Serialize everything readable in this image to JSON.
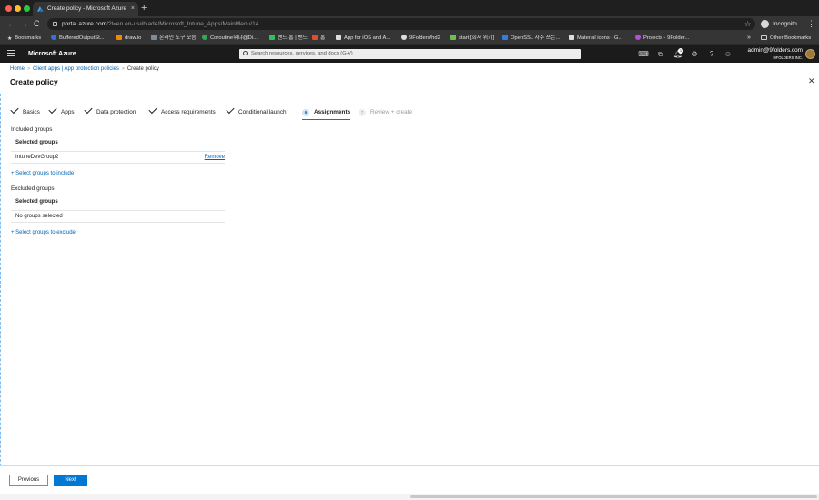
{
  "browser": {
    "tab_title": "Create policy - Microsoft Azure",
    "tab_close": "×",
    "new_tab": "+",
    "url_host": "portal.azure.com",
    "url_path": "/?l=en.en-us#blade/Microsoft_Intune_Apps/MainMenu/14",
    "profile_label": "Incognito",
    "nav_back": "←",
    "nav_forward": "→",
    "nav_reload": "C",
    "bookmark_star": "☆",
    "menu": "⋮",
    "bookmarks": [
      {
        "label": "Bookmarks",
        "color": "#e0e0e0"
      },
      {
        "label": "BufferedOutputSt...",
        "color": "#3b6fd8"
      },
      {
        "label": "draw.io",
        "color": "#f08705"
      },
      {
        "label": "온라인 도구 모음",
        "color": "#7d8b9a"
      },
      {
        "label": "Coroutine뭐냐@Di...",
        "color": "#32a852"
      },
      {
        "label": "밴드 홈 | 밴드",
        "color": "#2fc05a"
      },
      {
        "label": "홈",
        "color": "#e34b2f"
      },
      {
        "label": "App for iOS and A...",
        "color": "#dddddd"
      },
      {
        "label": "9Folders/hd2",
        "color": "#dddddd"
      },
      {
        "label": "start [회사 위키]",
        "color": "#6bbf4e"
      },
      {
        "label": "OpenSSL 자주 쓰는...",
        "color": "#2f7de1"
      },
      {
        "label": "Material icons - G...",
        "color": "#dddddd"
      },
      {
        "label": "Projects - 9Folder...",
        "color": "#b54fd8"
      }
    ],
    "bookmarks_more": "»",
    "other_bookmarks": "Other Bookmarks"
  },
  "azure": {
    "brand": "Microsoft Azure",
    "search_placeholder": "Search resources, services, and docs (G+/)",
    "notification_count": "1",
    "user_email": "admin@9folders.com",
    "user_org": "9FOLDERS INC."
  },
  "breadcrumb": {
    "home": "Home",
    "parent": "Client apps | App protection policies",
    "current": "Create policy"
  },
  "page": {
    "title": "Create policy",
    "close": "✕"
  },
  "steps": [
    {
      "label": "Basics",
      "state": "done"
    },
    {
      "label": "Apps",
      "state": "done"
    },
    {
      "label": "Data protection",
      "state": "done"
    },
    {
      "label": "Access requirements",
      "state": "done"
    },
    {
      "label": "Conditional launch",
      "state": "done"
    },
    {
      "label": "Assignments",
      "state": "active",
      "number": "6"
    },
    {
      "label": "Review + create",
      "state": "disabled",
      "number": "7"
    }
  ],
  "included": {
    "heading": "Included groups",
    "column": "Selected groups",
    "rows": [
      {
        "name": "IntuneDevGroup2",
        "action": "Remove"
      }
    ],
    "add_link": "+ Select groups to include"
  },
  "excluded": {
    "heading": "Excluded groups",
    "column": "Selected groups",
    "empty": "No groups selected",
    "add_link": "+ Select groups to exclude"
  },
  "footer": {
    "previous": "Previous",
    "next": "Next"
  }
}
